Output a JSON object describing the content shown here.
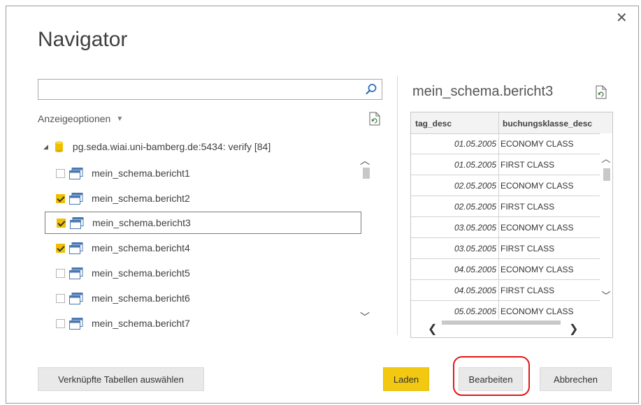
{
  "dialog": {
    "title": "Navigator",
    "close_glyph": "✕"
  },
  "search": {
    "value": "",
    "placeholder": "",
    "icon": "search-icon"
  },
  "display_options": {
    "label": "Anzeigeoptionen",
    "caret": "▼"
  },
  "tree": {
    "root_label": "pg.seda.wiai.uni-bamberg.de:5434: verify [84]",
    "items": [
      {
        "label": "mein_schema.bericht1",
        "checked": false,
        "selected": false
      },
      {
        "label": "mein_schema.bericht2",
        "checked": true,
        "selected": false
      },
      {
        "label": "mein_schema.bericht3",
        "checked": true,
        "selected": true
      },
      {
        "label": "mein_schema.bericht4",
        "checked": true,
        "selected": false
      },
      {
        "label": "mein_schema.bericht5",
        "checked": false,
        "selected": false
      },
      {
        "label": "mein_schema.bericht6",
        "checked": false,
        "selected": false
      },
      {
        "label": "mein_schema.bericht7",
        "checked": false,
        "selected": false
      }
    ]
  },
  "preview": {
    "title": "mein_schema.bericht3",
    "columns": [
      "tag_desc",
      "buchungsklasse_desc"
    ],
    "rows": [
      [
        "01.05.2005",
        "ECONOMY CLASS"
      ],
      [
        "01.05.2005",
        "FIRST CLASS"
      ],
      [
        "02.05.2005",
        "ECONOMY CLASS"
      ],
      [
        "02.05.2005",
        "FIRST CLASS"
      ],
      [
        "03.05.2005",
        "ECONOMY CLASS"
      ],
      [
        "03.05.2005",
        "FIRST CLASS"
      ],
      [
        "04.05.2005",
        "ECONOMY CLASS"
      ],
      [
        "04.05.2005",
        "FIRST CLASS"
      ],
      [
        "05.05.2005",
        "ECONOMY CLASS"
      ]
    ]
  },
  "buttons": {
    "select_linked": "Verknüpfte Tabellen auswählen",
    "load": "Laden",
    "edit": "Bearbeiten",
    "cancel": "Abbrechen"
  },
  "colors": {
    "accent": "#f2c811",
    "highlight_ring": "#e01818"
  }
}
